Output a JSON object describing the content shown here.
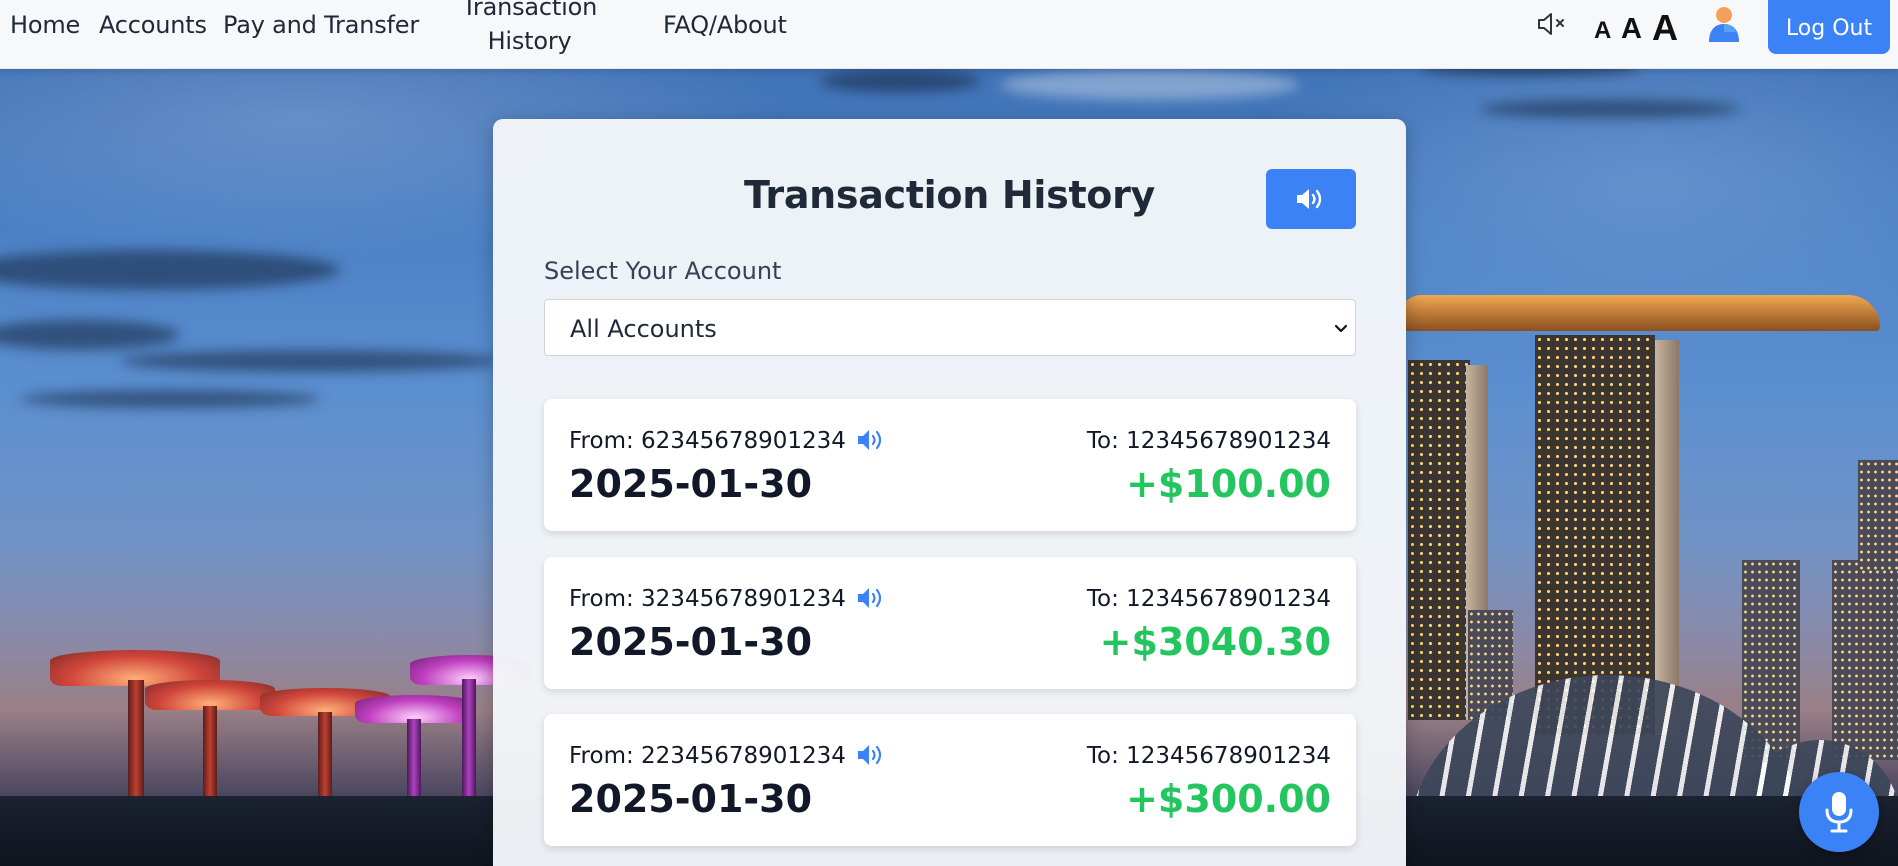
{
  "nav": {
    "links": [
      "Home",
      "Accounts",
      "Pay and Transfer",
      "Transaction\nHistory",
      "FAQ/About"
    ],
    "font_sizes": [
      "A",
      "A",
      "A"
    ],
    "logout_label": "Log Out",
    "icons": {
      "mute": "speaker-muted-icon",
      "avatar": "user-avatar-icon"
    }
  },
  "page": {
    "title": "Transaction History",
    "select_label": "Select Your Account",
    "selected_account": "All Accounts"
  },
  "transactions": [
    {
      "from": "From: 62345678901234",
      "to": "To: 12345678901234",
      "date": "2025-01-30",
      "amount": "+$100.00"
    },
    {
      "from": "From: 32345678901234",
      "to": "To: 12345678901234",
      "date": "2025-01-30",
      "amount": "+$3040.30"
    },
    {
      "from": "From: 22345678901234",
      "to": "To: 12345678901234",
      "date": "2025-01-30",
      "amount": "+$300.00"
    }
  ],
  "colors": {
    "accent": "#3b82f6",
    "positive_amount": "#22c55e",
    "text_dark": "#111827"
  }
}
